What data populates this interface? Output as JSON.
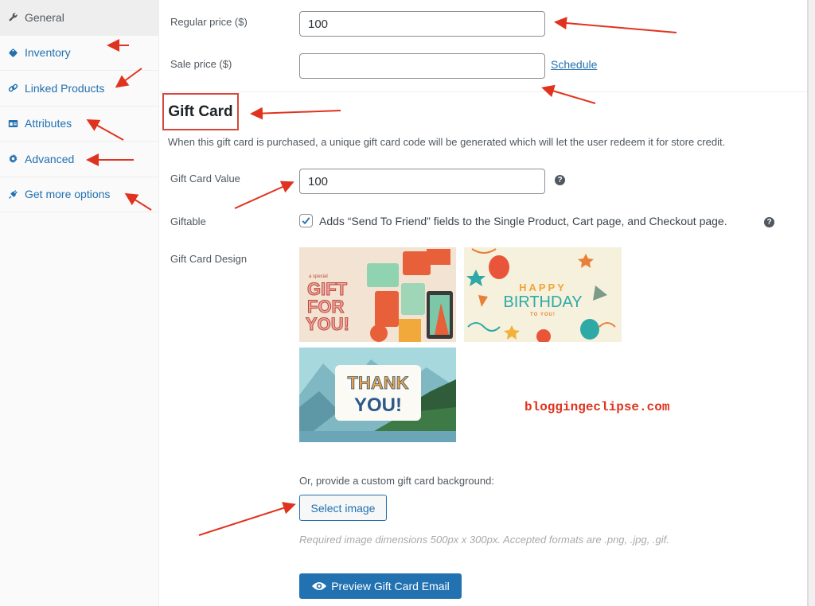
{
  "sidebar": {
    "items": [
      {
        "label": "General",
        "icon": "wrench-icon",
        "active": true
      },
      {
        "label": "Inventory",
        "icon": "tag-icon",
        "active": false
      },
      {
        "label": "Linked Products",
        "icon": "link-icon",
        "active": false
      },
      {
        "label": "Attributes",
        "icon": "list-card-icon",
        "active": false
      },
      {
        "label": "Advanced",
        "icon": "gear-icon",
        "active": false
      },
      {
        "label": "Get more options",
        "icon": "plug-icon",
        "active": false
      }
    ]
  },
  "pricing": {
    "regular_price_label": "Regular price ($)",
    "regular_price_value": "100",
    "sale_price_label": "Sale price ($)",
    "sale_price_value": "",
    "schedule_link": "Schedule"
  },
  "gift_card": {
    "heading": "Gift Card",
    "description": "When this gift card is purchased, a unique gift card code will be generated which will let the user redeem it for store credit.",
    "value_label": "Gift Card Value",
    "value": "100",
    "help_glyph": "?",
    "giftable_label": "Giftable",
    "giftable_checked": true,
    "giftable_text": "Adds “Send To Friend” fields to the Single Product, Cart page, and Checkout page.",
    "design_label": "Gift Card Design",
    "designs": [
      {
        "name": "Gift For You",
        "small_text": "a special",
        "lines": [
          "GIFT",
          "FOR",
          "YOU!"
        ]
      },
      {
        "name": "Happy Birthday",
        "lines": [
          "HAPPY",
          "BIRTHDAY",
          "TO YOU!"
        ]
      },
      {
        "name": "Thank You",
        "lines": [
          "THANK",
          "YOU!"
        ]
      }
    ],
    "custom_background_label": "Or, provide a custom gift card background:",
    "select_image_button": "Select image",
    "image_hint": "Required image dimensions 500px x 300px. Accepted formats are .png, .jpg, .gif.",
    "preview_button": "Preview Gift Card Email"
  },
  "watermark": "bloggingeclipse.com",
  "colors": {
    "accent": "#2271b1",
    "annotation": "#e0331f",
    "highlight_box": "#d6473a"
  }
}
